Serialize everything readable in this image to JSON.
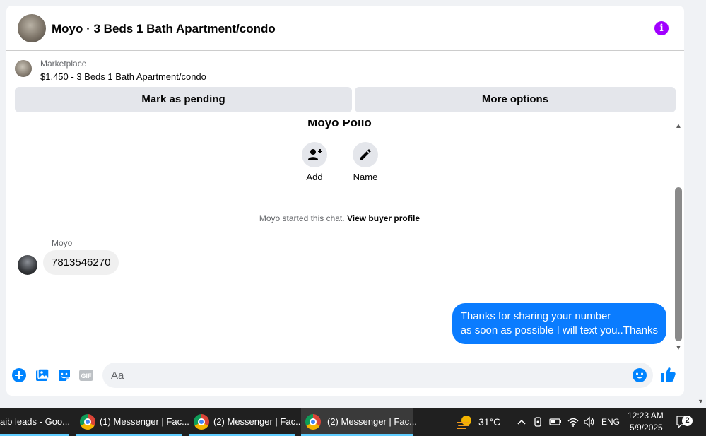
{
  "header": {
    "title": "Moyo · 3 Beds 1 Bath Apartment/condo",
    "info_icon": "info-icon"
  },
  "listing": {
    "label": "Marketplace",
    "price_title": "$1,450 - 3 Beds 1 Bath Apartment/condo",
    "mark_pending_label": "Mark as pending",
    "more_options_label": "More options"
  },
  "chat": {
    "contact_name": "Moyo Pollo",
    "actions": [
      {
        "label": "Add",
        "icon": "add-person-icon"
      },
      {
        "label": "Name",
        "icon": "pencil-icon"
      }
    ],
    "started_text": "Moyo started this chat.",
    "buyer_profile_link": "View buyer profile",
    "sender_name": "Moyo",
    "incoming_message": "7813546270",
    "outgoing_line1": "Thanks for sharing your number",
    "outgoing_line2": "as soon as possible I will text you..Thanks"
  },
  "composer": {
    "placeholder": "Aa",
    "icons": [
      "plus-icon",
      "photo-icon",
      "sticker-icon",
      "gif-icon",
      "emoji-icon",
      "thumbs-up-icon"
    ],
    "gif_label": "GIF"
  },
  "taskbar": {
    "tabs": [
      {
        "label": "aib leads - Goo..."
      },
      {
        "label": "(1) Messenger | Fac..."
      },
      {
        "label": "(2) Messenger | Fac..."
      },
      {
        "label": "(2) Messenger | Fac..."
      }
    ],
    "weather": "31°C",
    "language": "ENG",
    "time": "12:23 AM",
    "date": "5/9/2025",
    "notification_count": "2"
  },
  "colors": {
    "accent": "#0a7cff",
    "info": "#a100ff",
    "messenger_blue": "#0084ff"
  }
}
